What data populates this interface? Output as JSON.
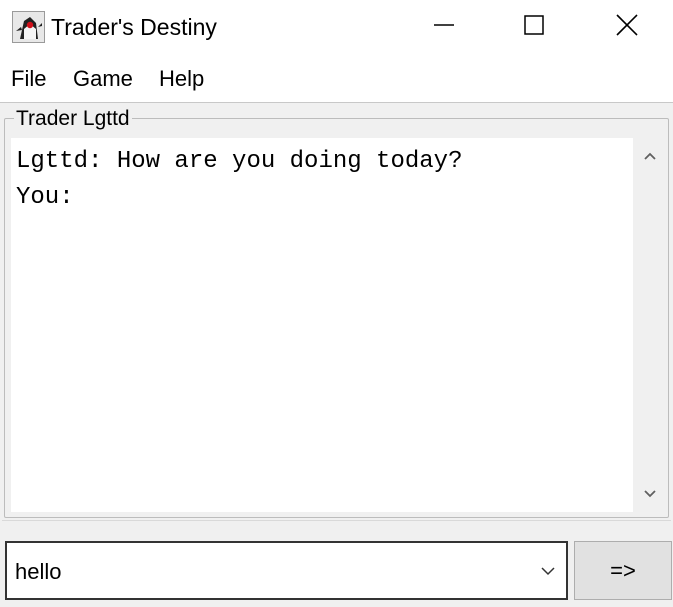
{
  "window": {
    "title": "Trader's Destiny",
    "icon": "java-duke-icon",
    "controls": [
      "minimize-icon",
      "maximize-icon",
      "close-icon"
    ]
  },
  "menu": {
    "items": [
      {
        "label": "File"
      },
      {
        "label": "Game"
      },
      {
        "label": "Help"
      }
    ]
  },
  "chat": {
    "panel_title": "Trader Lgttd",
    "lines": [
      "Lgttd: How are you doing today?",
      "You:"
    ]
  },
  "input": {
    "value": "hello",
    "send_label": "=>"
  },
  "colors": {
    "window_bg": "#f0f0f0",
    "text_bg": "#ffffff",
    "button_bg": "#e1e1e1"
  }
}
